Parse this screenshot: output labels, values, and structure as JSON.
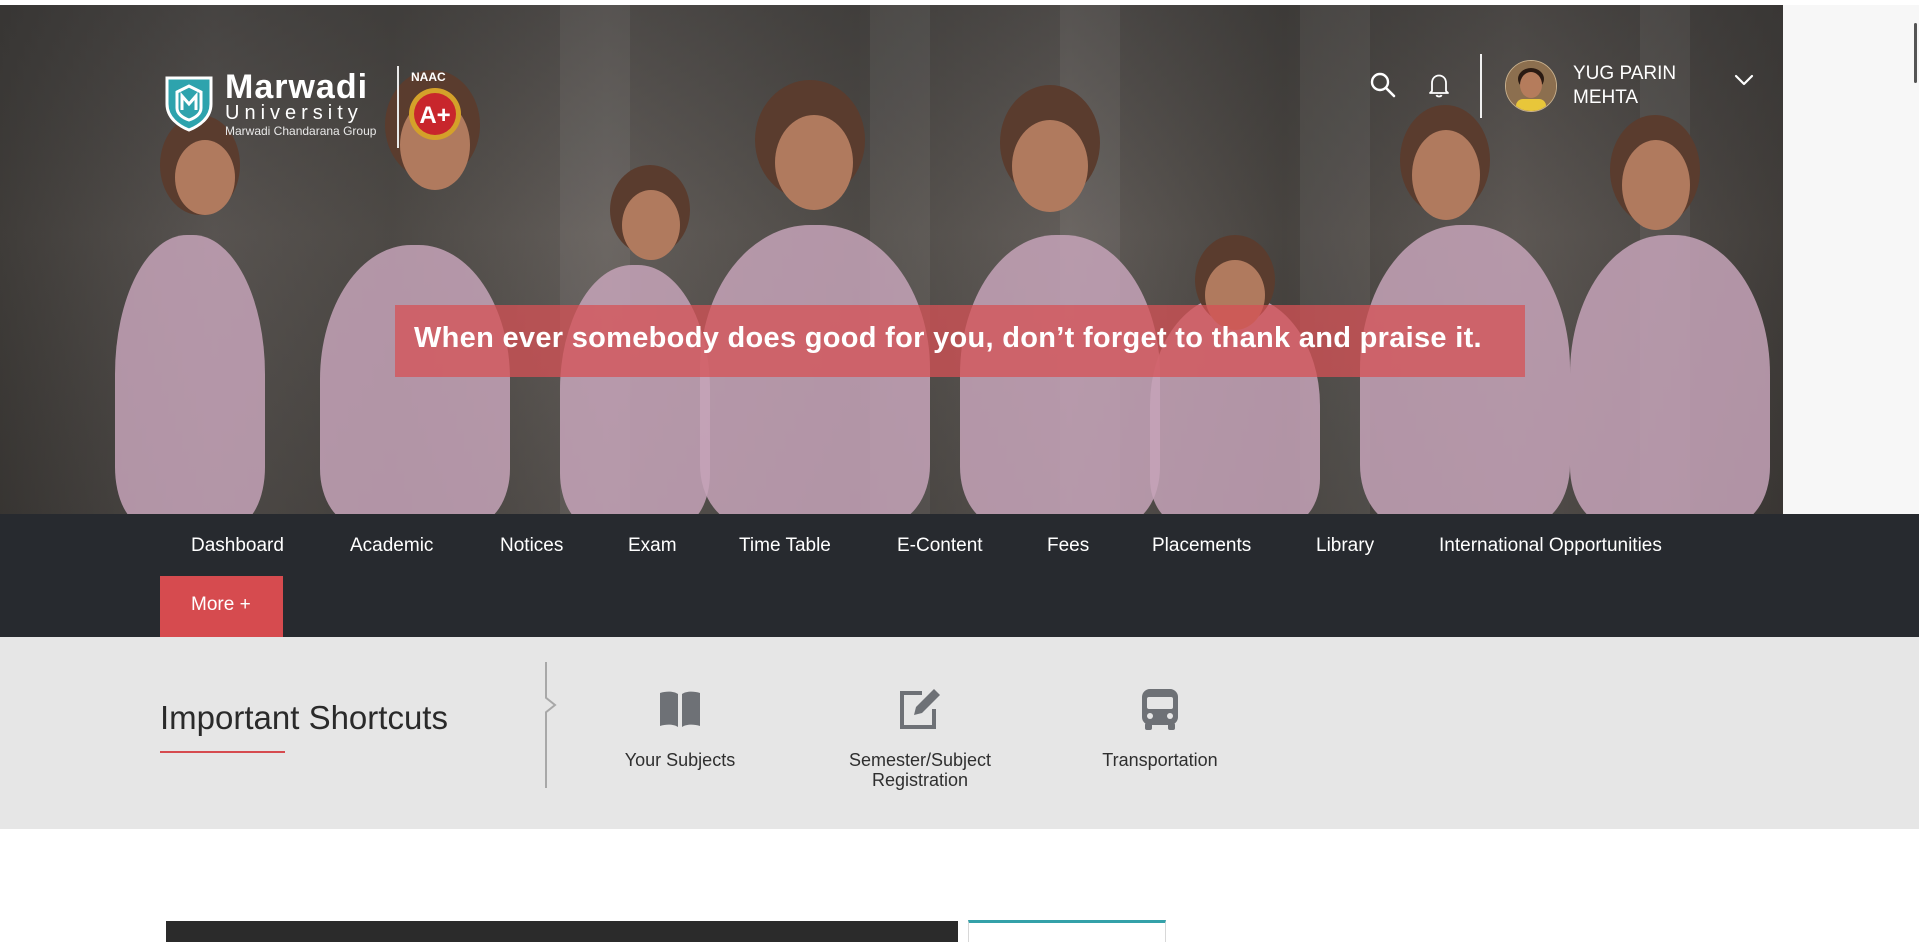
{
  "header": {
    "logo": {
      "brand_line1": "Marwadi",
      "brand_line2": "University",
      "group": "Marwadi Chandarana Group",
      "accreditation_label": "NAAC",
      "accreditation_grade": "A+"
    },
    "icons": [
      "search-icon",
      "bell-icon",
      "chevron-down-icon"
    ],
    "user": {
      "name": "YUG PARIN MEHTA"
    }
  },
  "hero": {
    "quote": "When ever somebody does good for you, don’t forget to thank and praise it."
  },
  "nav": {
    "items": [
      {
        "label": "Dashboard"
      },
      {
        "label": "Academic"
      },
      {
        "label": "Notices"
      },
      {
        "label": "Exam"
      },
      {
        "label": "Time Table"
      },
      {
        "label": "E-Content"
      },
      {
        "label": "Fees"
      },
      {
        "label": "Placements"
      },
      {
        "label": "Library"
      },
      {
        "label": "International Opportunities"
      }
    ],
    "more_label": "More +"
  },
  "shortcuts": {
    "title": "Important Shortcuts",
    "items": [
      {
        "label": "Your Subjects",
        "icon": "book-icon"
      },
      {
        "label": "Semester/Subject Registration",
        "icon": "edit-icon"
      },
      {
        "label": "Transportation",
        "icon": "bus-icon"
      }
    ]
  },
  "colors": {
    "accent": "#d64b4f",
    "nav_bg": "#272a2f",
    "shortcuts_bg": "#e6e6e6",
    "teal": "#34a1a9"
  }
}
